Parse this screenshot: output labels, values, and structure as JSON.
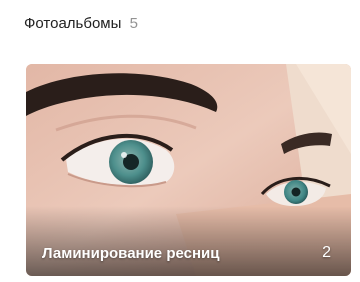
{
  "section": {
    "title": "Фотоальбомы",
    "count": "5"
  },
  "albums": [
    {
      "title": "Ламинирование ресниц",
      "photo_count": "2",
      "cover": "eye-closeup-photo"
    }
  ],
  "colors": {
    "title_text": "#222222",
    "count_text": "#939393",
    "overlay_text": "#ffffff"
  }
}
